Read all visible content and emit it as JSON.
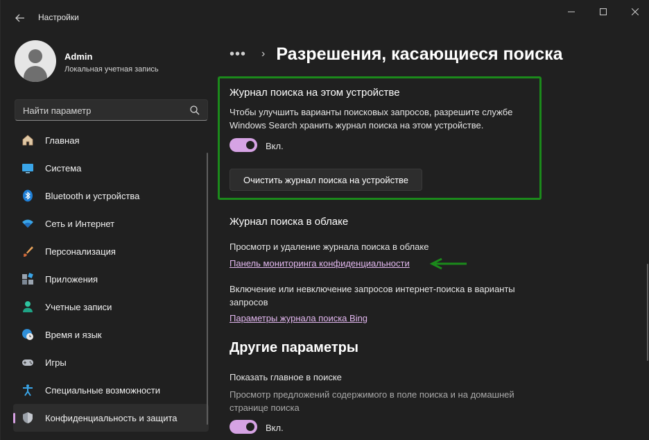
{
  "window": {
    "title": "Настройки"
  },
  "profile": {
    "name": "Admin",
    "account_type": "Локальная учетная запись"
  },
  "search": {
    "placeholder": "Найти параметр"
  },
  "sidebar": {
    "items": [
      {
        "label": "Главная",
        "icon": "home-icon"
      },
      {
        "label": "Система",
        "icon": "system-icon"
      },
      {
        "label": "Bluetooth и устройства",
        "icon": "bluetooth-icon"
      },
      {
        "label": "Сеть и Интернет",
        "icon": "wifi-icon"
      },
      {
        "label": "Персонализация",
        "icon": "brush-icon"
      },
      {
        "label": "Приложения",
        "icon": "apps-icon"
      },
      {
        "label": "Учетные записи",
        "icon": "account-icon"
      },
      {
        "label": "Время и язык",
        "icon": "globe-clock-icon"
      },
      {
        "label": "Игры",
        "icon": "gamepad-icon"
      },
      {
        "label": "Специальные возможности",
        "icon": "accessibility-icon"
      },
      {
        "label": "Конфиденциальность и защита",
        "icon": "shield-icon",
        "active": true
      }
    ]
  },
  "header": {
    "breadcrumb_more": "•••",
    "page_title": "Разрешения, касающиеся поиска"
  },
  "device_history": {
    "title": "Журнал поиска на этом устройстве",
    "description_line1": "Чтобы улучшить варианты поисковых запросов, разрешите службе",
    "description_line2": "Windows Search хранить журнал поиска на этом устройстве.",
    "toggle_state": "Вкл.",
    "toggle_on": true,
    "clear_button": "Очистить журнал поиска на устройстве"
  },
  "cloud_history": {
    "title": "Журнал поиска в облаке",
    "view_text": "Просмотр и удаление журнала поиска в облаке",
    "privacy_link": "Панель мониторинга конфиденциальности",
    "bing_text_line1": "Включение или невключение запросов интернет-поиска в варианты",
    "bing_text_line2": "запросов",
    "bing_link": "Параметры журнала поиска Bing"
  },
  "other": {
    "title": "Другие параметры",
    "highlights_title": "Показать главное в поиске",
    "highlights_desc_line1": "Просмотр предложений содержимого в поле поиска и на домашней",
    "highlights_desc_line2": "странице поиска",
    "toggle_state": "Вкл.",
    "toggle_on": true
  },
  "colors": {
    "accent": "#d6a3e4",
    "annotation_green": "#1b8a1b",
    "background": "#202020"
  }
}
